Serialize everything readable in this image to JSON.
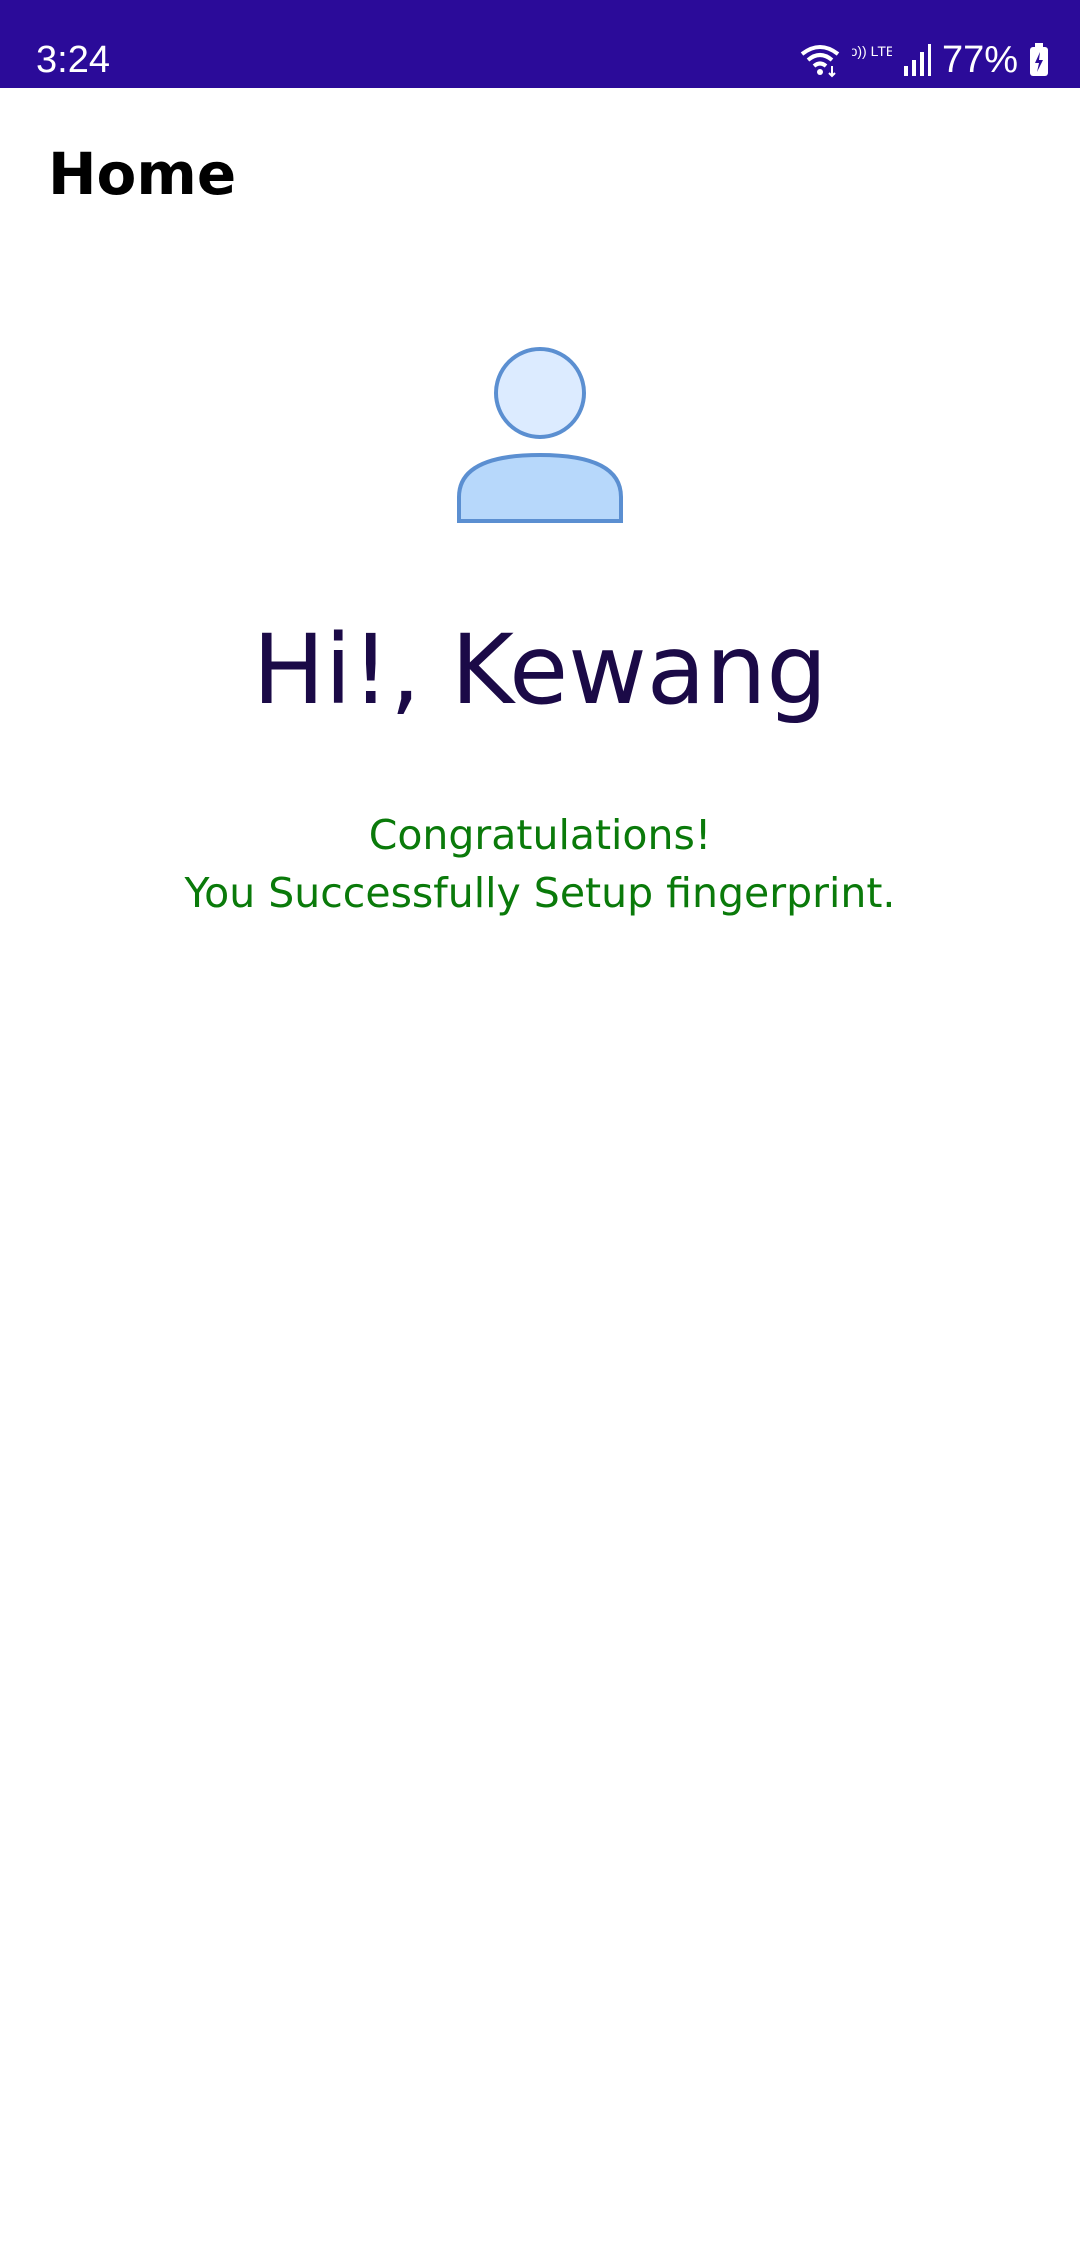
{
  "status_bar": {
    "time": "3:24",
    "network_label": "Vo)) LTE1",
    "battery": "77%",
    "icons": [
      "wifi-icon",
      "volte-icon",
      "signal-icon",
      "battery-icon"
    ],
    "background": "#2b0b99"
  },
  "app_bar": {
    "title": "Home"
  },
  "profile": {
    "avatar_icon": "user-avatar-icon",
    "greeting": "Hi!, Kewang"
  },
  "message": {
    "line1": "Congratulations!",
    "line2": "You Successfully Setup fingerprint.",
    "color": "#0a7a0a"
  }
}
